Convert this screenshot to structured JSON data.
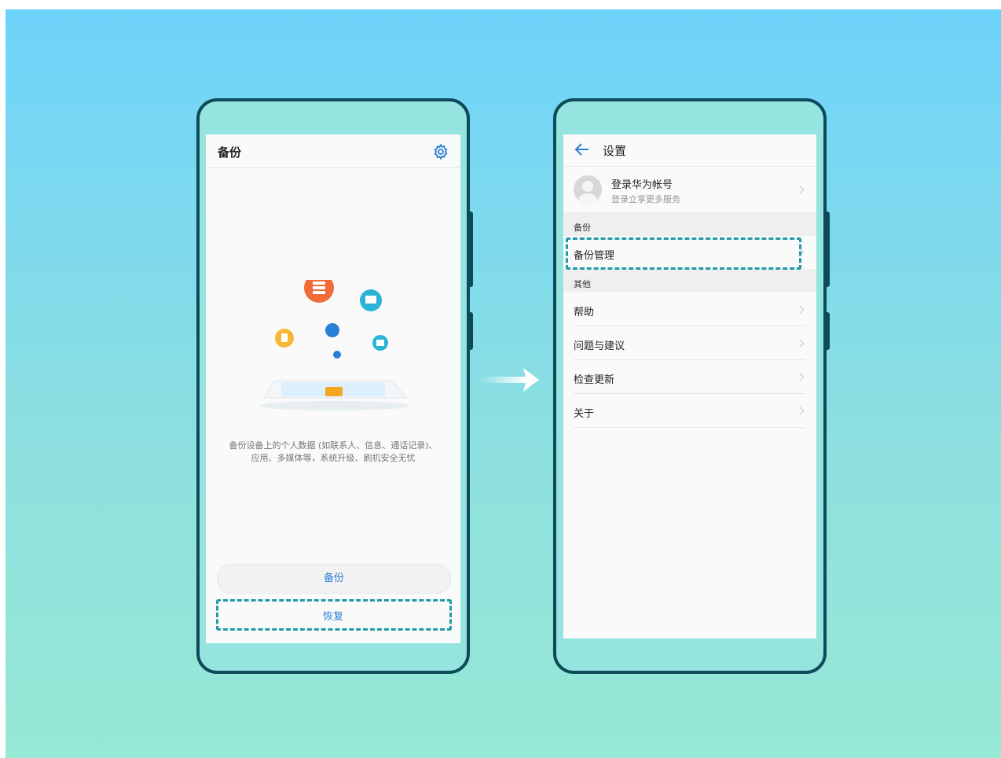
{
  "left_screen": {
    "title": "备份",
    "description_line1": "备份设备上的个人数据 (如联系人、信息、通话记录)、",
    "description_line2": "应用、多媒体等，系统升级、刷机安全无忧",
    "backup_button": "备份",
    "restore_button": "恢复",
    "settings_icon": "gear-icon"
  },
  "right_screen": {
    "title": "设置",
    "back_icon": "back-arrow-icon",
    "account": {
      "name": "登录华为帐号",
      "subtitle": "登录立享更多服务"
    },
    "sections": [
      {
        "header": "备份",
        "items": [
          "备份管理"
        ]
      },
      {
        "header": "其他",
        "items": [
          "帮助",
          "问题与建议",
          "检查更新",
          "关于"
        ]
      }
    ]
  },
  "colors": {
    "accent": "#2a7fd6",
    "highlight_dash": "#1f9ba8",
    "phone_frame": "#0d4a5a",
    "background_top": "#6ed3fb",
    "background_bottom": "#97e8d5"
  }
}
